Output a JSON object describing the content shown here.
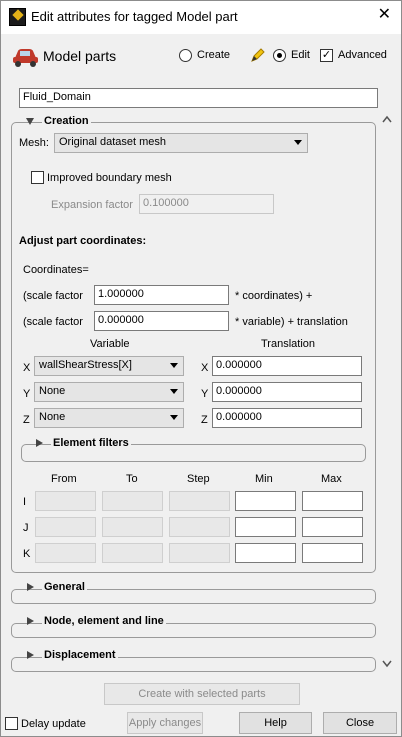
{
  "window": {
    "title": "Edit attributes for tagged Model part"
  },
  "header": {
    "label": "Model parts",
    "create_label": "Create",
    "edit_label": "Edit",
    "advanced_label": "Advanced"
  },
  "part_name": "Fluid_Domain",
  "creation": {
    "title": "Creation",
    "mesh_label": "Mesh:",
    "mesh_value": "Original dataset mesh",
    "improved_label": "Improved boundary mesh",
    "expansion_label": "Expansion factor",
    "expansion_value": "0.100000",
    "adjust_title": "Adjust part coordinates:",
    "coordinates_label": "Coordinates=",
    "scale1_label": "(scale factor",
    "scale1_value": "1.000000",
    "scale1_suffix": "* coordinates) +",
    "scale2_label": "(scale factor",
    "scale2_value": "0.000000",
    "scale2_suffix": "* variable) + translation",
    "variable_header": "Variable",
    "translation_header": "Translation",
    "rows": [
      {
        "axis": "X",
        "variable": "wallShearStress[X]",
        "taxis": "X",
        "translation": "0.000000"
      },
      {
        "axis": "Y",
        "variable": "None",
        "taxis": "Y",
        "translation": "0.000000"
      },
      {
        "axis": "Z",
        "variable": "None",
        "taxis": "Z",
        "translation": "0.000000"
      }
    ],
    "element_filters_title": "Element filters",
    "filter_headers": [
      "From",
      "To",
      "Step",
      "Min",
      "Max"
    ],
    "filter_rows": [
      "I",
      "J",
      "K"
    ]
  },
  "sections": {
    "general": "General",
    "node": "Node, element and line",
    "displacement": "Displacement"
  },
  "footer": {
    "create_button": "Create with selected parts",
    "delay_label": "Delay update",
    "apply_button": "Apply changes",
    "help_button": "Help",
    "close_button": "Close"
  }
}
